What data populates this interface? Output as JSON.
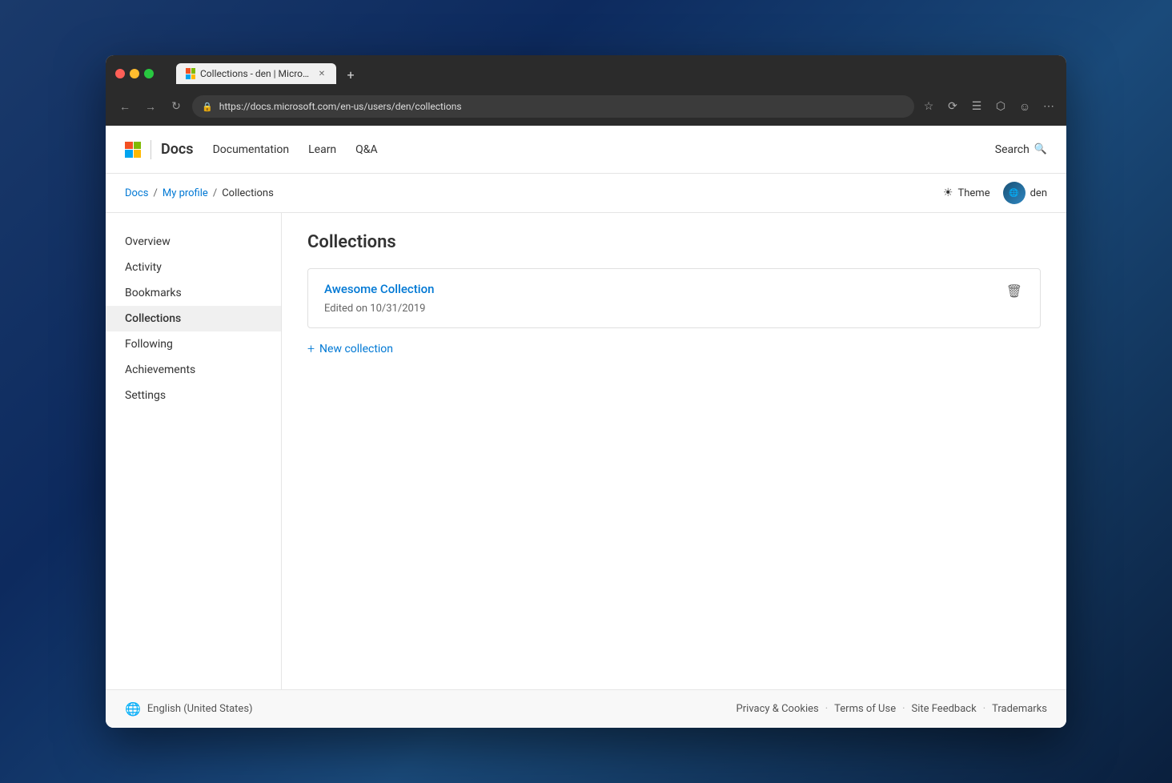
{
  "browser": {
    "tab_title": "Collections - den | Microsoft Do",
    "tab_url": "https://docs.microsoft.com/en-us/users/den/collections",
    "url_display": {
      "prefix": "",
      "domain": "https://docs.microsoft.com",
      "path": "/en-us/users/den/collections"
    },
    "new_tab_label": "+"
  },
  "topnav": {
    "logo_text": "Microsoft",
    "docs_label": "Docs",
    "links": [
      {
        "label": "Documentation"
      },
      {
        "label": "Learn"
      },
      {
        "label": "Q&A"
      }
    ],
    "search_label": "Search"
  },
  "breadcrumb": {
    "items": [
      {
        "label": "Docs",
        "href": "#"
      },
      {
        "label": "My profile",
        "href": "#"
      },
      {
        "label": "Collections",
        "current": true
      }
    ],
    "theme_label": "Theme",
    "user_name": "den"
  },
  "sidebar": {
    "items": [
      {
        "label": "Overview",
        "active": false
      },
      {
        "label": "Activity",
        "active": false
      },
      {
        "label": "Bookmarks",
        "active": false
      },
      {
        "label": "Collections",
        "active": true
      },
      {
        "label": "Following",
        "active": false
      },
      {
        "label": "Achievements",
        "active": false
      },
      {
        "label": "Settings",
        "active": false
      }
    ]
  },
  "main": {
    "page_title": "Collections",
    "collections": [
      {
        "name": "Awesome Collection",
        "meta": "Edited on 10/31/2019"
      }
    ],
    "new_collection_label": "New collection"
  },
  "footer": {
    "locale": "English (United States)",
    "links": [
      {
        "label": "Privacy & Cookies"
      },
      {
        "label": "Terms of Use"
      },
      {
        "label": "Site Feedback"
      },
      {
        "label": "Trademarks"
      }
    ]
  }
}
